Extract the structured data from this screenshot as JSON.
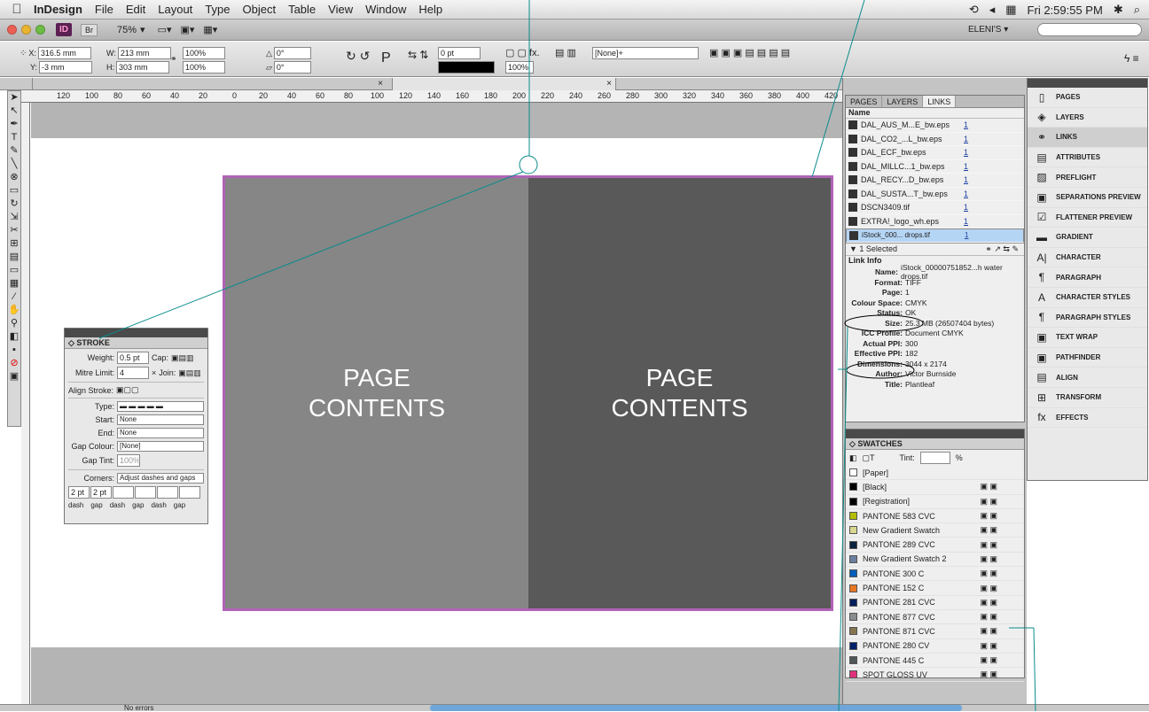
{
  "menubar": {
    "app": "InDesign",
    "items": [
      "File",
      "Edit",
      "Layout",
      "Type",
      "Object",
      "Table",
      "View",
      "Window",
      "Help"
    ],
    "clock": "Fri 2:59:55 PM"
  },
  "titlebar": {
    "zoom": "75%",
    "workspace": "ELENI'S ▾",
    "id_label": "ID",
    "br_label": "Br"
  },
  "control": {
    "x": "316.5 mm",
    "y": "-3 mm",
    "w": "213 mm",
    "h": "303 mm",
    "scale_x": "100%",
    "scale_y": "100%",
    "angle": "0°",
    "shear": "0°",
    "stroke": "0 pt",
    "fill": "[None]+",
    "opacity": "100%"
  },
  "pages": {
    "left_text": "PAGE CONTENTS",
    "right_text": "PAGE CONTENTS"
  },
  "stroke": {
    "title": "STROKE",
    "weight_label": "Weight:",
    "weight": "0.5 pt",
    "cap_label": "Cap:",
    "mitre_label": "Mitre Limit:",
    "mitre": "4",
    "join_label": "Join:",
    "align_label": "Align Stroke:",
    "type_label": "Type:",
    "start_label": "Start:",
    "start": "None",
    "end_label": "End:",
    "end": "None",
    "gapcolour_label": "Gap Colour:",
    "gapcolour": "[None]",
    "gaptint_label": "Gap Tint:",
    "gaptint": "100%",
    "corners_label": "Corners:",
    "corners": "Adjust dashes and gaps",
    "dash1": "2 pt",
    "gap1": "2 pt",
    "dash_word": "dash",
    "gap_word": "gap"
  },
  "links": {
    "tabs": [
      "PAGES",
      "LAYERS",
      "LINKS"
    ],
    "name_header": "Name",
    "rows": [
      {
        "name": "DAL_AUS_M...E_bw.eps",
        "page": "1"
      },
      {
        "name": "DAL_CO2_...L_bw.eps",
        "page": "1"
      },
      {
        "name": "DAL_ECF_bw.eps",
        "page": "1"
      },
      {
        "name": "DAL_MILLC...1_bw.eps",
        "page": "1"
      },
      {
        "name": "DAL_RECY...D_bw.eps",
        "page": "1"
      },
      {
        "name": "DAL_SUSTA...T_bw.eps",
        "page": "1"
      },
      {
        "name": "DSCN3409.tif",
        "page": "1"
      },
      {
        "name": "EXTRA!_logo_wh.eps",
        "page": "1"
      },
      {
        "name": "iStock_000... drops.tif",
        "page": "1"
      }
    ],
    "selected": "1 Selected",
    "info_title": "Link Info",
    "info": [
      {
        "k": "Name:",
        "v": "iStock_00000751852...h water drops.tif"
      },
      {
        "k": "Format:",
        "v": "TIFF"
      },
      {
        "k": "Page:",
        "v": "1"
      },
      {
        "k": "Colour Space:",
        "v": "CMYK"
      },
      {
        "k": "Status:",
        "v": "OK"
      },
      {
        "k": "Size:",
        "v": "25.3 MB (26507404 bytes)"
      },
      {
        "k": "ICC Profile:",
        "v": "Document CMYK"
      },
      {
        "k": "Actual PPI:",
        "v": "300"
      },
      {
        "k": "Effective PPI:",
        "v": "182"
      },
      {
        "k": "Dimensions:",
        "v": "3044 x 2174"
      },
      {
        "k": "Author:",
        "v": "Victor Burnside"
      },
      {
        "k": "Title:",
        "v": "Plantleaf"
      }
    ]
  },
  "swatches": {
    "title": "SWATCHES",
    "tint_label": "Tint:",
    "tint_unit": "%",
    "items": [
      {
        "name": "[Paper]",
        "color": "#ffffff"
      },
      {
        "name": "[Black]",
        "color": "#000000"
      },
      {
        "name": "[Registration]",
        "color": "#000000"
      },
      {
        "name": "PANTONE 583 CVC",
        "color": "#b5bd00"
      },
      {
        "name": "New Gradient Swatch",
        "color": "#d8d890"
      },
      {
        "name": "PANTONE 289 CVC",
        "color": "#0c2340"
      },
      {
        "name": "New Gradient Swatch 2",
        "color": "#6a7fa0"
      },
      {
        "name": "PANTONE 300 C",
        "color": "#005eb8"
      },
      {
        "name": "PANTONE 152 C",
        "color": "#e87722"
      },
      {
        "name": "PANTONE 281 CVC",
        "color": "#00205b"
      },
      {
        "name": "PANTONE 877 CVC",
        "color": "#8a8d8f"
      },
      {
        "name": "PANTONE 871 CVC",
        "color": "#84754e"
      },
      {
        "name": "PANTONE 280 CV",
        "color": "#012169"
      },
      {
        "name": "PANTONE 445 C",
        "color": "#505759"
      },
      {
        "name": "SPOT GLOSS UV",
        "color": "#e0307a"
      }
    ]
  },
  "dock": {
    "items": [
      "PAGES",
      "LAYERS",
      "LINKS",
      "ATTRIBUTES",
      "PREFLIGHT",
      "SEPARATIONS PREVIEW",
      "FLATTENER PREVIEW",
      "GRADIENT",
      "CHARACTER",
      "PARAGRAPH",
      "CHARACTER STYLES",
      "PARAGRAPH STYLES",
      "TEXT WRAP",
      "PATHFINDER",
      "ALIGN",
      "TRANSFORM",
      "EFFECTS"
    ]
  },
  "status": {
    "errors": "No errors"
  }
}
